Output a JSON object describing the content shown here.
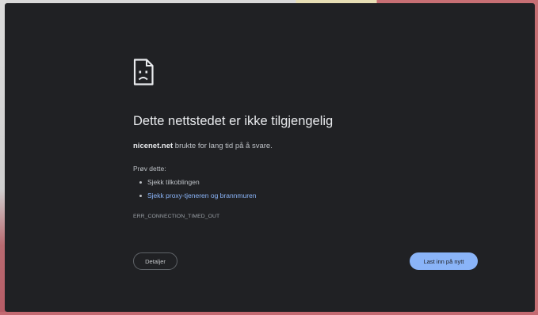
{
  "error_page": {
    "icon": "sad-document-icon",
    "title": "Dette nettstedet er ikke tilgjengelig",
    "host": "nicenet.net",
    "description_rest": " brukte for lang tid på å svare.",
    "try_label": "Prøv dette:",
    "suggestions": [
      {
        "text": "Sjekk tilkoblingen",
        "is_link": false
      },
      {
        "text": "Sjekk proxy-tjeneren og brannmuren",
        "is_link": true
      }
    ],
    "error_code": "ERR_CONNECTION_TIMED_OUT",
    "details_label": "Detaljer",
    "reload_label": "Last inn på nytt"
  },
  "colors": {
    "background": "#202124",
    "text_primary": "#e8eaed",
    "text_secondary": "#bdc1c6",
    "link": "#8ab4f8",
    "button_primary": "#8ab4f8"
  }
}
